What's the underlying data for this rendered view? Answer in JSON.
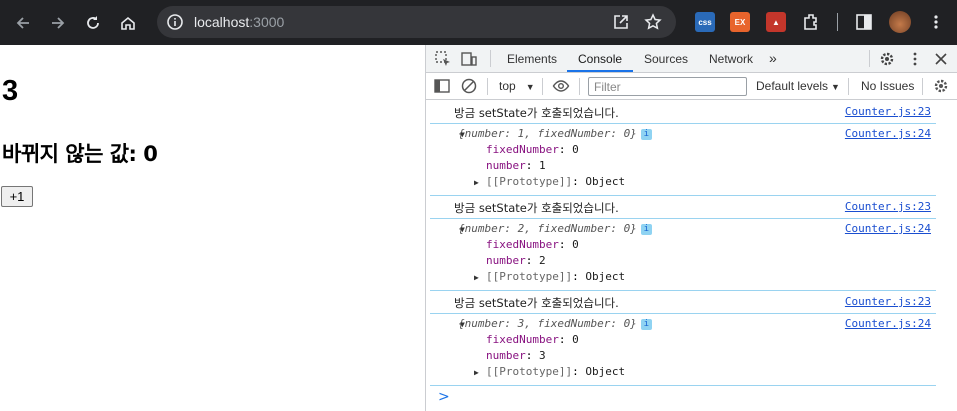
{
  "browser": {
    "url_host": "localhost",
    "url_port": ":3000"
  },
  "page": {
    "count": "3",
    "fixed_text": "바뀌지 않는 값: 0",
    "button_label": "+1"
  },
  "devtools": {
    "tabs": [
      "Elements",
      "Console",
      "Sources",
      "Network"
    ],
    "active_tab": "Console",
    "context": "top",
    "filter_placeholder": "Filter",
    "levels": "Default levels",
    "issues": "No Issues"
  },
  "console": {
    "entries": [
      {
        "log": "방금 setState가 호출되었습니다.",
        "log_src": "Counter.js:23",
        "obj_src": "Counter.js:24",
        "obj_head": "{number: 1, fixedNumber: 0}",
        "fixed_key": "fixedNumber",
        "fixed_val": "0",
        "number_key": "number",
        "number_val": "1",
        "proto": "[[Prototype]]",
        "proto_val": "Object"
      },
      {
        "log": "방금 setState가 호출되었습니다.",
        "log_src": "Counter.js:23",
        "obj_src": "Counter.js:24",
        "obj_head": "{number: 2, fixedNumber: 0}",
        "fixed_key": "fixedNumber",
        "fixed_val": "0",
        "number_key": "number",
        "number_val": "2",
        "proto": "[[Prototype]]",
        "proto_val": "Object"
      },
      {
        "log": "방금 setState가 호출되었습니다.",
        "log_src": "Counter.js:23",
        "obj_src": "Counter.js:24",
        "obj_head": "{number: 3, fixedNumber: 0}",
        "fixed_key": "fixedNumber",
        "fixed_val": "0",
        "number_key": "number",
        "number_val": "3",
        "proto": "[[Prototype]]",
        "proto_val": "Object"
      }
    ],
    "prompt": ">"
  },
  "icons": [
    "back-icon",
    "forward-icon",
    "reload-icon",
    "home-icon",
    "site-info-icon",
    "share-icon",
    "bookmark-star-icon",
    "extensions-icon",
    "side-panel-icon",
    "profile-avatar",
    "menu-icon",
    "inspect-icon",
    "device-toolbar-icon",
    "more-tabs-icon",
    "settings-icon",
    "close-icon",
    "sidebar-toggle-icon",
    "clear-console-icon",
    "eye-icon"
  ],
  "colors": {
    "chrome_bg": "#202124",
    "link": "#1a4ed0",
    "active_tab": "#1a73e8",
    "prop_key": "#881280"
  }
}
